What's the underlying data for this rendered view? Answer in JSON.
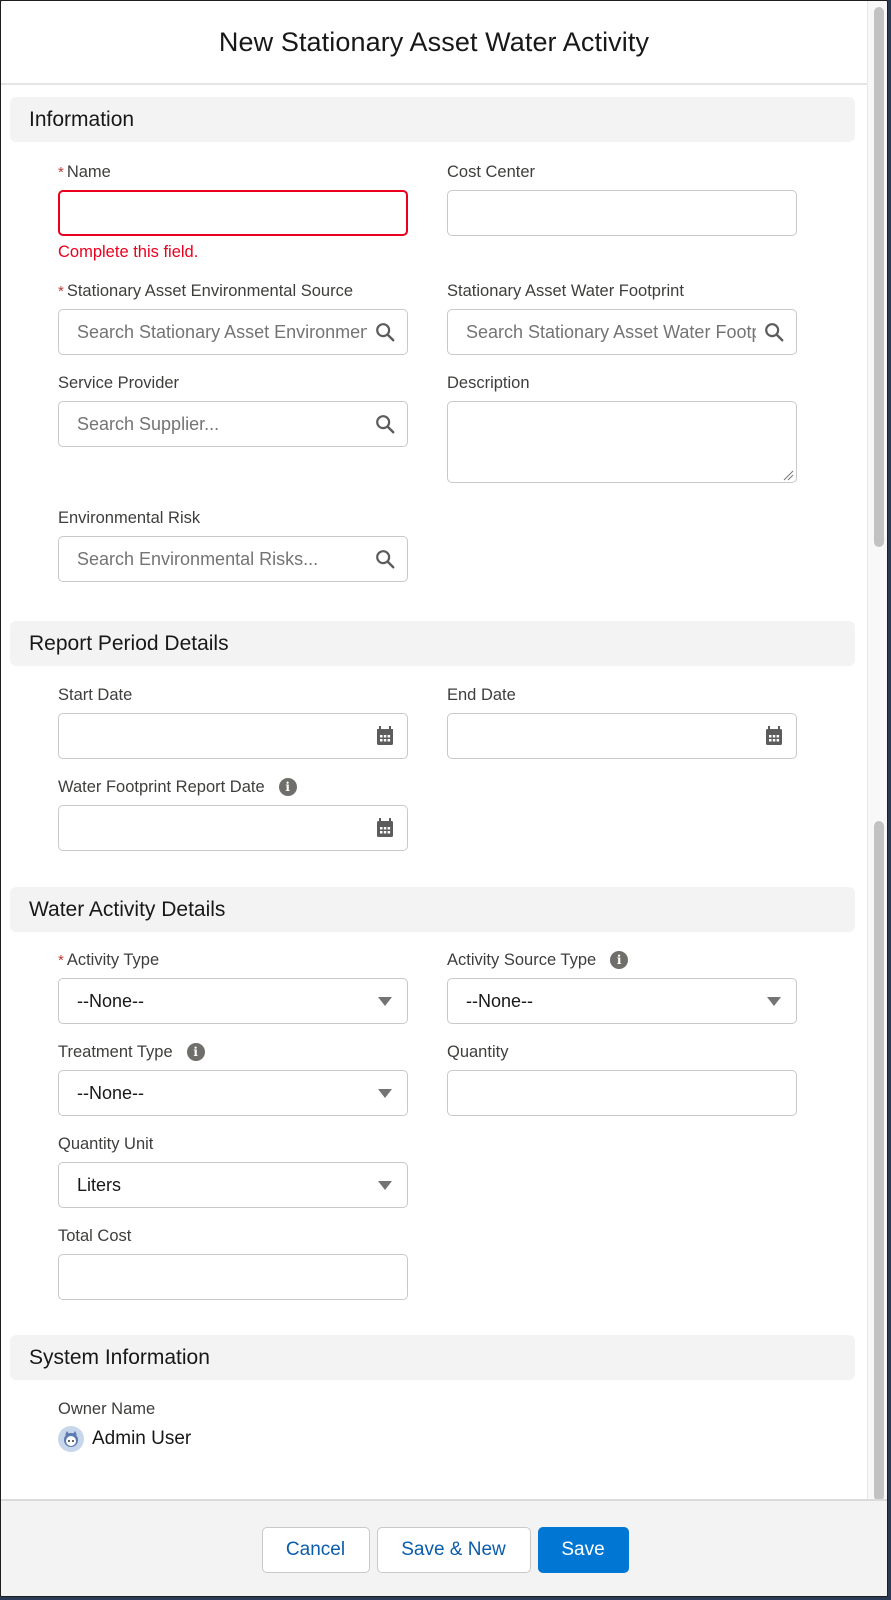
{
  "modal": {
    "title": "New Stationary Asset Water Activity"
  },
  "sections": {
    "information": {
      "title": "Information",
      "name": {
        "label": "Name",
        "required": true,
        "value": "",
        "error": "Complete this field."
      },
      "cost_center": {
        "label": "Cost Center",
        "value": ""
      },
      "environmental_source": {
        "label": "Stationary Asset Environmental Source",
        "required": true,
        "placeholder": "Search Stationary Asset Environmental Sources..."
      },
      "water_footprint": {
        "label": "Stationary Asset Water Footprint",
        "placeholder": "Search Stationary Asset Water Footprints..."
      },
      "service_provider": {
        "label": "Service Provider",
        "placeholder": "Search Supplier..."
      },
      "description": {
        "label": "Description",
        "value": ""
      },
      "environmental_risk": {
        "label": "Environmental Risk",
        "placeholder": "Search Environmental Risks..."
      }
    },
    "report_period": {
      "title": "Report Period Details",
      "start_date": {
        "label": "Start Date",
        "value": ""
      },
      "end_date": {
        "label": "End Date",
        "value": ""
      },
      "report_date": {
        "label": "Water Footprint Report Date",
        "value": "",
        "has_info": true
      }
    },
    "water_activity": {
      "title": "Water Activity Details",
      "activity_type": {
        "label": "Activity Type",
        "required": true,
        "selected": "--None--"
      },
      "activity_source_type": {
        "label": "Activity Source Type",
        "selected": "--None--",
        "has_info": true
      },
      "treatment_type": {
        "label": "Treatment Type",
        "selected": "--None--",
        "has_info": true
      },
      "quantity": {
        "label": "Quantity",
        "value": ""
      },
      "quantity_unit": {
        "label": "Quantity Unit",
        "selected": "Liters"
      },
      "total_cost": {
        "label": "Total Cost",
        "value": ""
      }
    },
    "system": {
      "title": "System Information",
      "owner_label": "Owner Name",
      "owner_name": "Admin User"
    }
  },
  "footer": {
    "cancel_label": "Cancel",
    "save_new_label": "Save & New",
    "save_label": "Save"
  },
  "colors": {
    "brand": "#0176d3",
    "error": "#ea001e",
    "required": "#c23934"
  },
  "glyphs": {
    "required": "*",
    "info": "i"
  }
}
